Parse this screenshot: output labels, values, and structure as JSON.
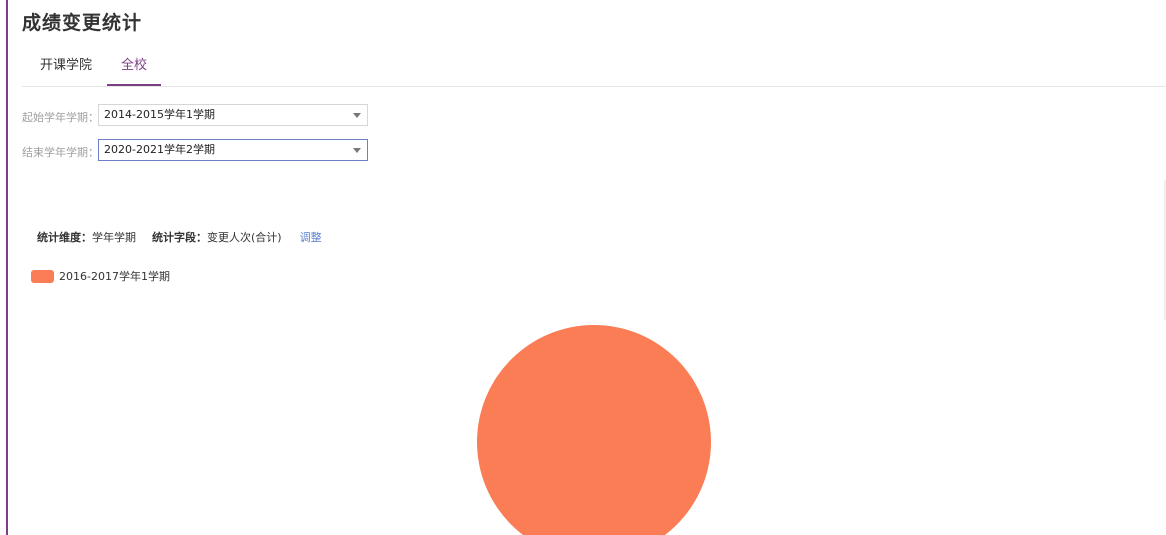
{
  "page": {
    "title": "成绩变更统计"
  },
  "tabs": [
    {
      "label": "开课学院",
      "active": false
    },
    {
      "label": "全校",
      "active": true
    }
  ],
  "filters": {
    "start_label": "起始学年学期：",
    "start_value": "2014-2015学年1学期",
    "end_label": "结束学年学期：",
    "end_value": "2020-2021学年2学期"
  },
  "stats": {
    "dimension_label": "统计维度：",
    "dimension_value": "学年学期",
    "field_label": "统计字段：",
    "field_value": "变更人次(合计)",
    "adjust_label": "调整"
  },
  "colors": {
    "accent": "#7b3f84",
    "pie": "#fb7d56",
    "link": "#5a7fd0"
  },
  "chart_data": {
    "type": "pie",
    "categories": [
      "2016-2017学年1学期"
    ],
    "values": [
      1
    ],
    "legend": "top-left",
    "colors": [
      "#fb7d56"
    ]
  }
}
